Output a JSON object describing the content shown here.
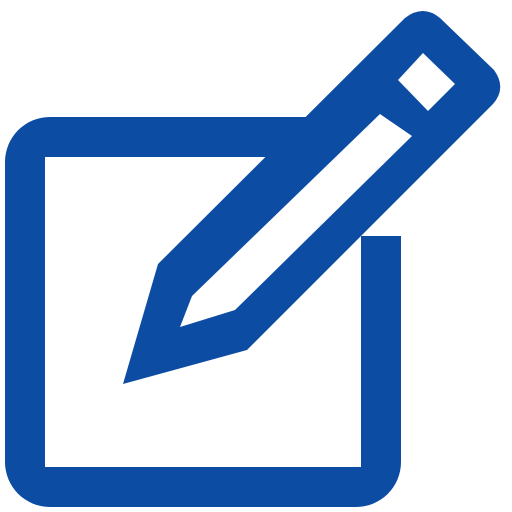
{
  "icon": {
    "name": "edit-icon",
    "color": "#0d4ca3"
  }
}
